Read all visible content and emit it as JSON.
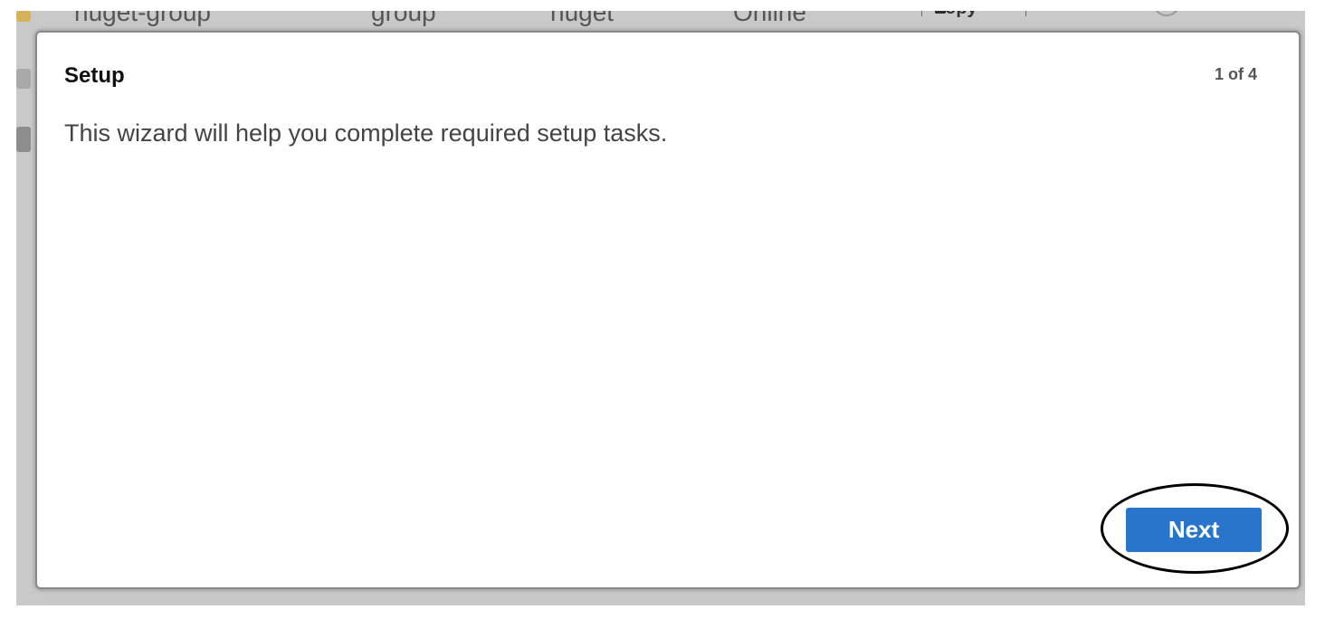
{
  "background_table": {
    "row": {
      "name": "nuget-group",
      "type": "group",
      "format": "nuget",
      "status": "Online",
      "copy_label": "copy"
    }
  },
  "modal": {
    "title": "Setup",
    "step": "1 of 4",
    "body_text": "This wizard will help you complete required setup tasks.",
    "next_label": "Next"
  },
  "colors": {
    "primary_button": "#2a75cc",
    "overlay": "#c9c9c9"
  }
}
